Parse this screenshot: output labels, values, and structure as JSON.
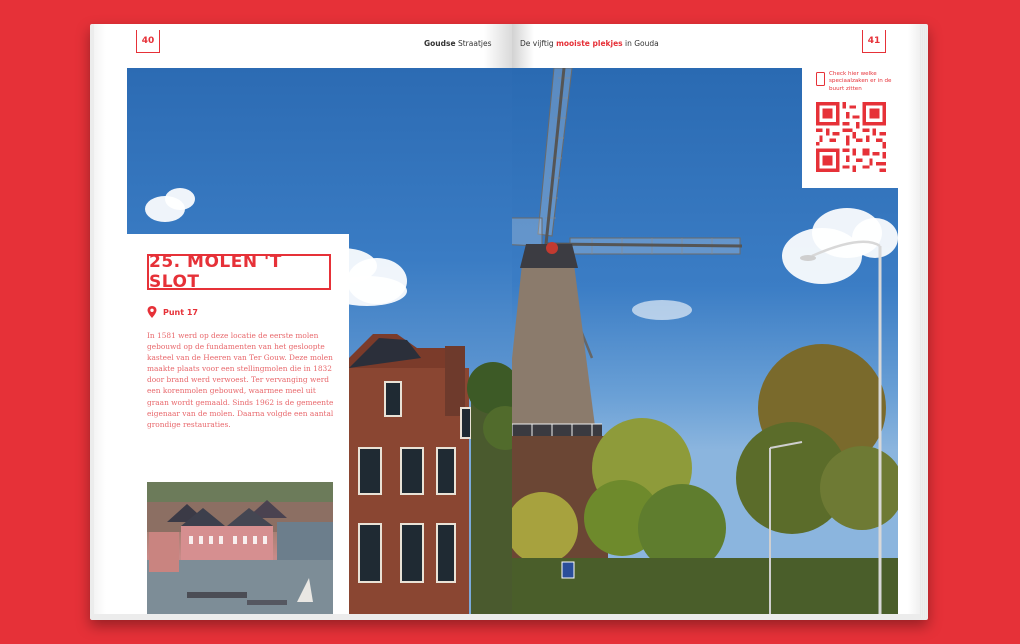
{
  "left_page": {
    "page_number": "40",
    "running_head": {
      "bold": "Goudse",
      "rest": " Straatjes"
    },
    "title": "25. MOLEN 'T SLOT",
    "location": "Punt 17",
    "body": "In 1581 werd op deze locatie de eerste molen gebouwd op de fundamenten van het gesloopte kasteel van de Heeren van Ter Gouw. Deze molen maakte plaats voor een stellingmolen die in 1832 door brand werd verwoest. Ter vervanging werd een korenmolen gebouwd, waarmee meel uit graan wordt gemaald. Sinds 1962 is de gemeente eigenaar van de molen. Daarna volgde een aantal grondige restauraties."
  },
  "right_page": {
    "page_number": "41",
    "running_head": {
      "pre": "De vijftig ",
      "accent": "mooiste plekjes",
      "post": " in Gouda"
    },
    "qr_caption": "Check hier welke speciaalzaken er in de buurt zitten"
  },
  "colors": {
    "accent": "#e63138",
    "background": "#e63138",
    "body_text": "#e8686c"
  },
  "icons": {
    "location": "map-pin-icon",
    "phone": "phone-icon",
    "qr": "qr-code-icon"
  }
}
